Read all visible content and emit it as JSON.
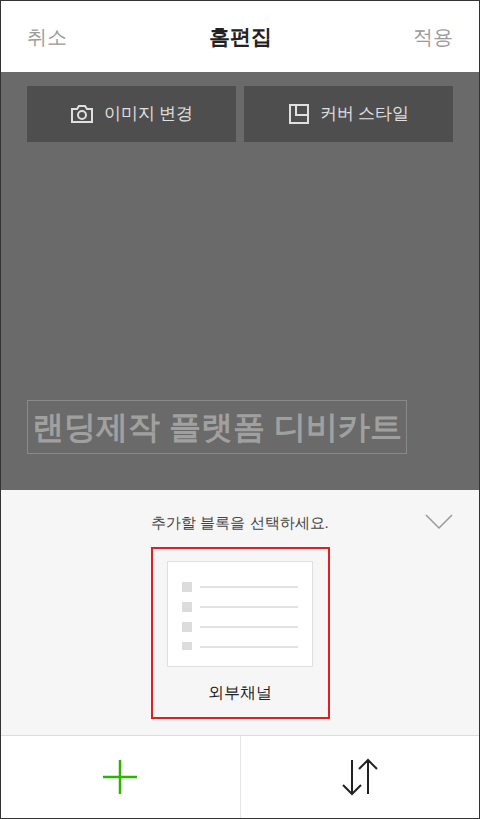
{
  "top_bar": {
    "cancel": "취소",
    "title": "홈편집",
    "apply": "적용"
  },
  "cover": {
    "buttons": [
      {
        "label": "이미지 변경",
        "kind": "camera"
      },
      {
        "label": "커버 스타일",
        "kind": "style"
      }
    ],
    "title": "랜딩제작 플랫폼 디비카트"
  },
  "sheet": {
    "prompt": "추가할 블록을 선택하세요.",
    "blocks": [
      {
        "label": "외부채널",
        "selected": true
      }
    ]
  }
}
